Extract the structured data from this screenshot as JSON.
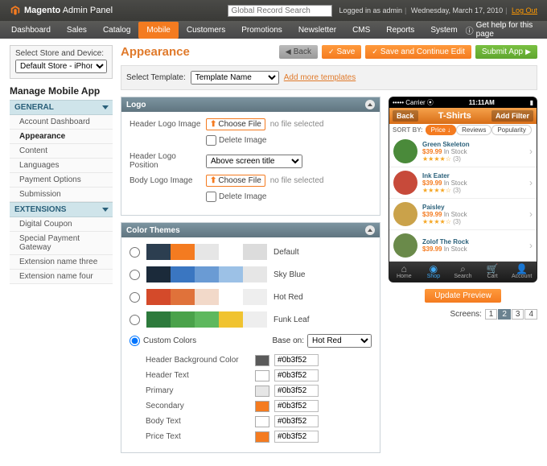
{
  "header": {
    "brand_a": "Magento",
    "brand_b": "Admin Panel",
    "search_placeholder": "Global Record Search",
    "logged_in": "Logged in as admin",
    "date": "Wednesday, March 17, 2010",
    "logout": "Log Out"
  },
  "nav": {
    "items": [
      "Dashboard",
      "Sales",
      "Catalog",
      "Mobile",
      "Customers",
      "Promotions",
      "Newsletter",
      "CMS",
      "Reports",
      "System"
    ],
    "active": "Mobile",
    "help": "Get help for this page"
  },
  "sidebar": {
    "store_label": "Select Store and Device:",
    "store_value": "Default Store - iPhone",
    "manage_title": "Manage Mobile App",
    "cat_general": "GENERAL",
    "general": [
      "Account Dashboard",
      "Appearance",
      "Content",
      "Languages",
      "Payment Options",
      "Submission"
    ],
    "general_active": "Appearance",
    "cat_ext": "EXTENSIONS",
    "extensions": [
      "Digital Coupon",
      "Special Payment Gateway",
      "Extension name three",
      "Extension name four"
    ]
  },
  "page": {
    "title": "Appearance",
    "btn_back": "Back",
    "btn_save": "Save",
    "btn_save_edit": "Save and Continue Edit",
    "btn_submit": "Submit App"
  },
  "template": {
    "label": "Select Template:",
    "value": "Template Name",
    "add_more": "Add more templates"
  },
  "logo_panel": {
    "title": "Logo",
    "header_logo": "Header Logo Image",
    "choose_file": "Choose File",
    "no_file": "no file selected",
    "delete_image": "Delete Image",
    "header_pos": "Header Logo Position",
    "header_pos_val": "Above screen title",
    "body_logo": "Body Logo Image"
  },
  "themes_panel": {
    "title": "Color Themes",
    "rows": [
      {
        "name": "Default",
        "colors": [
          "#2c3e50",
          "#f47b20",
          "#e6e6e6",
          "#ffffff",
          "#dcdcdc"
        ]
      },
      {
        "name": "Sky Blue",
        "colors": [
          "#1b2a3a",
          "#3a76c1",
          "#6a9bd4",
          "#9cc1e6",
          "#e6e6e6"
        ]
      },
      {
        "name": "Hot Red",
        "colors": [
          "#d44a2a",
          "#e0723a",
          "#f2d9c9",
          "#ffffff",
          "#eeeeee"
        ]
      },
      {
        "name": "Funk Leaf",
        "colors": [
          "#2d7a3c",
          "#4aa24a",
          "#5eb85e",
          "#f0c330",
          "#eeeeee"
        ]
      }
    ],
    "custom_label": "Custom Colors",
    "base_on": "Base on:",
    "base_val": "Hot Red",
    "fields": [
      {
        "label": "Header Background Color",
        "swatch": "#5a5a5a",
        "val": "#0b3f52"
      },
      {
        "label": "Header Text",
        "swatch": "#ffffff",
        "val": "#0b3f52"
      },
      {
        "label": "Primary",
        "swatch": "#e6e6e6",
        "val": "#0b3f52"
      },
      {
        "label": "Secondary",
        "swatch": "#f47b20",
        "val": "#0b3f52"
      },
      {
        "label": "Body Text",
        "swatch": "#ffffff",
        "val": "#0b3f52"
      },
      {
        "label": "Price Text",
        "swatch": "#f47b20",
        "val": "#0b3f52"
      }
    ]
  },
  "preview": {
    "carrier": "Carrier",
    "time": "11:11AM",
    "back": "Back",
    "title": "T-Shirts",
    "filter": "Add Filter",
    "sort_by": "SORT BY:",
    "sort_opts": [
      "Price",
      "Reviews",
      "Popularity"
    ],
    "sort_active": "Price",
    "products": [
      {
        "name": "Green Skeleton",
        "price": "$39.99",
        "stock": "In Stock",
        "reviews": "3",
        "img": "#4a8a3a"
      },
      {
        "name": "Ink Eater",
        "price": "$39.99",
        "stock": "In Stock",
        "reviews": "3",
        "img": "#c74a3a"
      },
      {
        "name": "Paisley",
        "price": "$39.99",
        "stock": "In Stock",
        "reviews": "3",
        "img": "#caa24a"
      },
      {
        "name": "Zolof The Rock",
        "price": "$39.99",
        "stock": "In Stock",
        "reviews": "",
        "img": "#6a8a4a"
      }
    ],
    "tabs": [
      "Home",
      "Shop",
      "Search",
      "Cart",
      "Account"
    ],
    "tab_active": "Shop",
    "update": "Update Preview",
    "screens_label": "Screens:",
    "screens": [
      "1",
      "2",
      "3",
      "4"
    ],
    "screen_active": "2"
  }
}
